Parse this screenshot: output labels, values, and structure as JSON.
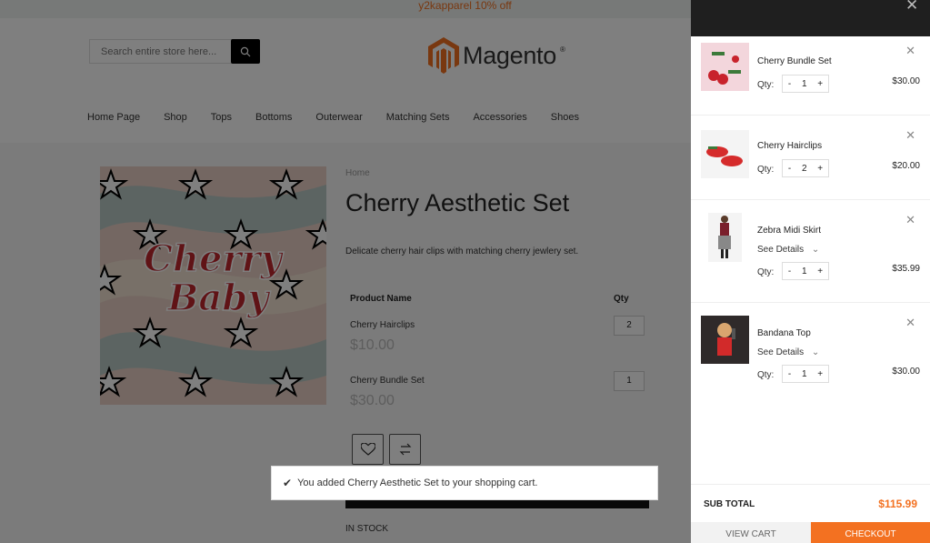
{
  "promo": {
    "text": "y2kapparel 10% off"
  },
  "header": {
    "search_placeholder": "Search entire store here...",
    "logo_text": "Magento",
    "logo_registered": "®"
  },
  "nav": [
    "Home Page",
    "Shop",
    "Tops",
    "Bottoms",
    "Outerwear",
    "Matching Sets",
    "Accessories",
    "Shoes"
  ],
  "product": {
    "breadcrumb": "Home",
    "title": "Cherry Aesthetic Set",
    "description": "Delicate cherry hair clips with matching cherry jewlery set.",
    "image_text_line1": "Cherry",
    "image_text_line2": "Baby",
    "col_name": "Product Name",
    "col_qty": "Qty",
    "items": [
      {
        "name": "Cherry Hairclips",
        "price": "$10.00",
        "qty": "2"
      },
      {
        "name": "Cherry Bundle Set",
        "price": "$30.00",
        "qty": "1"
      }
    ],
    "stock": "IN STOCK"
  },
  "toast": {
    "message": "You added Cherry Aesthetic Set to your shopping cart."
  },
  "minicart": {
    "qty_label": "Qty:",
    "see_details": "See Details",
    "items": [
      {
        "name": "Cherry Bundle Set",
        "qty": "1",
        "price": "$30.00"
      },
      {
        "name": "Cherry Hairclips",
        "qty": "2",
        "price": "$20.00"
      },
      {
        "name": "Zebra Midi Skirt",
        "qty": "1",
        "price": "$35.99"
      },
      {
        "name": "Bandana Top",
        "qty": "1",
        "price": "$30.00"
      }
    ],
    "subtotal_label": "SUB TOTAL",
    "subtotal_value": "$115.99",
    "view_cart": "VIEW CART",
    "checkout": "CHECKOUT"
  },
  "colors": {
    "accent": "#f37121",
    "dark": "#111111"
  }
}
